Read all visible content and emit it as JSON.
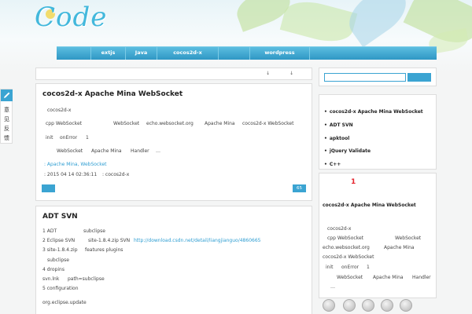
{
  "site": {
    "logo_text": "Code"
  },
  "nav": [
    {
      "label": ""
    },
    {
      "label": "extjs"
    },
    {
      "label": "Java"
    },
    {
      "label": "cocos2d-x"
    },
    {
      "label": ""
    },
    {
      "label": "wordpress"
    },
    {
      "label": ""
    }
  ],
  "toolbar": {
    "arrow1": "↓",
    "arrow2": "↓"
  },
  "side_tab": {
    "chars": [
      "意",
      "见",
      "反",
      "馈"
    ]
  },
  "post1": {
    "title": "cocos2d-x    Apache Mina  WebSocket",
    "l1": "cocos2d-x",
    "l2a": "cpp   WebSocket",
    "l2b": "WebSocket",
    "l2c": "echo.websocket.org",
    "l2d": "Apache Mina",
    "l2e": "cocos2d-x WebSocket",
    "l3a": "init",
    "l3b": "onError",
    "l3c": "1",
    "l4a": "WebSocket",
    "l4b": "Apache Mina",
    "l4c": "Handler",
    "l4d": "…",
    "tags": ": Apache Mina, WebSocket",
    "meta_date": ": 2015 04 14  02:36:11",
    "meta_cat": ":   cocos2d-x",
    "count": "65"
  },
  "post2": {
    "title": "ADT    SVN",
    "l1a": "1    ADT",
    "l1b": "subclipse",
    "l2a": "2    Eclipse SVN",
    "l2b": "site-1.8.4.zip   SVN",
    "l2c": "http://download.csdn.net/detail/liangjianguo/4860665",
    "l3a": "3      site-1.8.4.zip",
    "l3b": "features plugins",
    "l4": "subclipse",
    "l5": "4    dropins",
    "l6a": "svn.lnk",
    "l6b": "path=subclipse",
    "l7": "5    configuration",
    "l8": "org.eclipse.update"
  },
  "sidebar": {
    "recent": [
      "cocos2d-x    Apache Mina  WebSocket",
      "ADT    SVN",
      "apktool",
      "jQuery Validate",
      "C++"
    ],
    "random_num": "1",
    "random_title": "cocos2d-x    Apache Mina  WebSocket",
    "random_l1": "cocos2d-x",
    "random_l2a": "cpp   WebSocket",
    "random_l2b": "WebSocket",
    "random_l3a": "echo.websocket.org",
    "random_l3b": "Apache Mina",
    "random_l4": "cocos2d-x WebSocket",
    "random_l5a": "init",
    "random_l5b": "onError",
    "random_l5c": "1",
    "random_l6a": "WebSocket",
    "random_l6b": "Apache Mina",
    "random_l6c": "Handler",
    "random_l7": "…"
  },
  "social": [
    "weibo-icon",
    "qq-icon",
    "rss-icon",
    "email-icon",
    "share-icon"
  ],
  "colors": {
    "accent": "#3ba4d2",
    "nav": "#3ba4d2",
    "link": "#2f9ed2",
    "badge": "#e5262f"
  }
}
